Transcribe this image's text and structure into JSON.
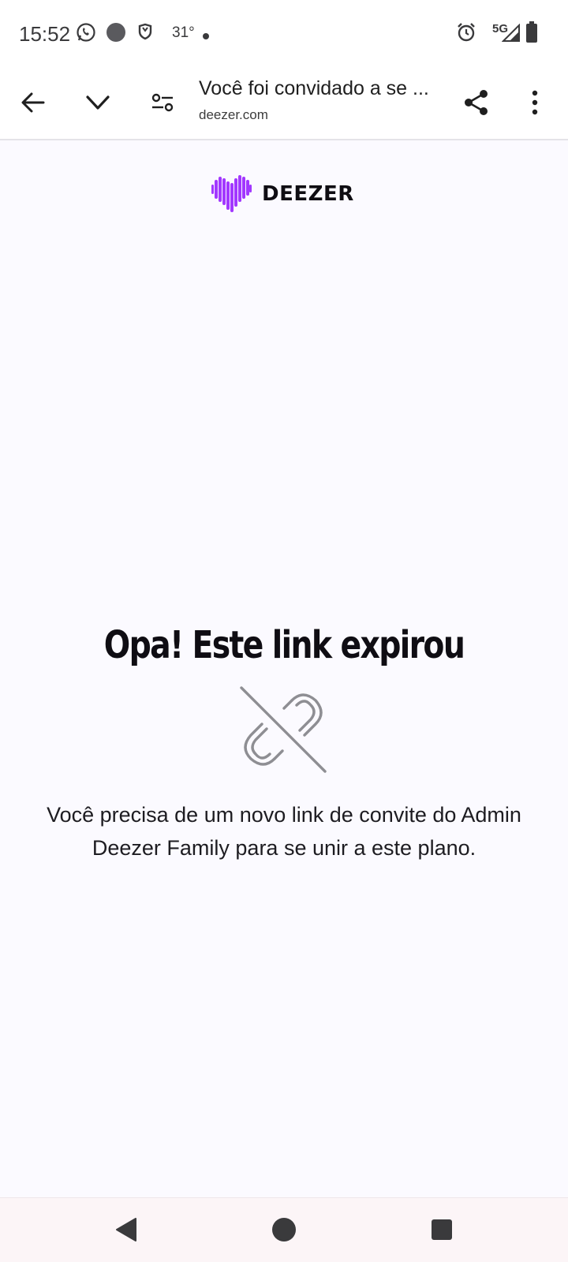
{
  "status_bar": {
    "time": "15:52",
    "temperature": "31°",
    "network": "5G",
    "icons": [
      "whatsapp-icon",
      "circle-notification-icon",
      "shield-icon",
      "dot-icon",
      "alarm-icon",
      "signal-icon",
      "battery-icon"
    ]
  },
  "browser": {
    "page_title": "Você foi convidado a se ...",
    "url": "deezer.com",
    "icons": [
      "back-arrow-icon",
      "chevron-down-icon",
      "site-settings-icon",
      "share-icon",
      "more-vert-icon"
    ]
  },
  "page": {
    "logo_text": "DEEZER",
    "headline": "Opa! Este link expirou",
    "message_line1": "Você precisa de um novo link de convite do Admin",
    "message_line2": "Deezer Family para se unir a este plano.",
    "brand_color": "#a238ff"
  },
  "nav_bar": {
    "icons": [
      "back-triangle-icon",
      "home-circle-icon",
      "recents-square-icon"
    ]
  }
}
